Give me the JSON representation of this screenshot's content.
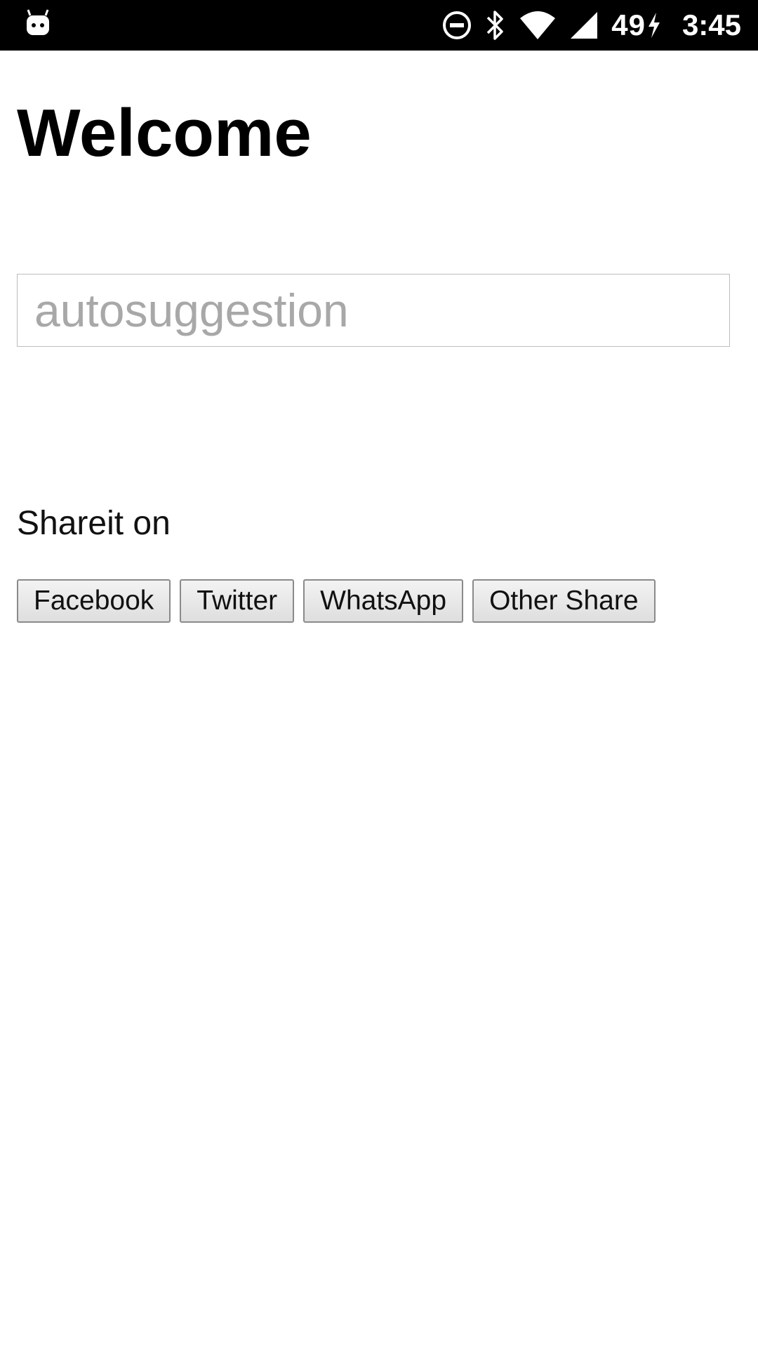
{
  "status_bar": {
    "battery_level": "49",
    "time": "3:45",
    "icons": [
      "android-notification-icon",
      "do-not-disturb-icon",
      "bluetooth-icon",
      "wifi-icon",
      "cellular-signal-icon",
      "charging-bolt-icon"
    ]
  },
  "page": {
    "title": "Welcome"
  },
  "search": {
    "placeholder": "autosuggestion",
    "value": ""
  },
  "share": {
    "label": "Shareit on",
    "buttons": {
      "facebook": "Facebook",
      "twitter": "Twitter",
      "whatsapp": "WhatsApp",
      "other": "Other Share"
    }
  },
  "colors": {
    "status_bar_bg": "#000000",
    "background": "#ffffff",
    "placeholder_text": "#a8a8a8",
    "input_border": "#bdbdbd"
  }
}
